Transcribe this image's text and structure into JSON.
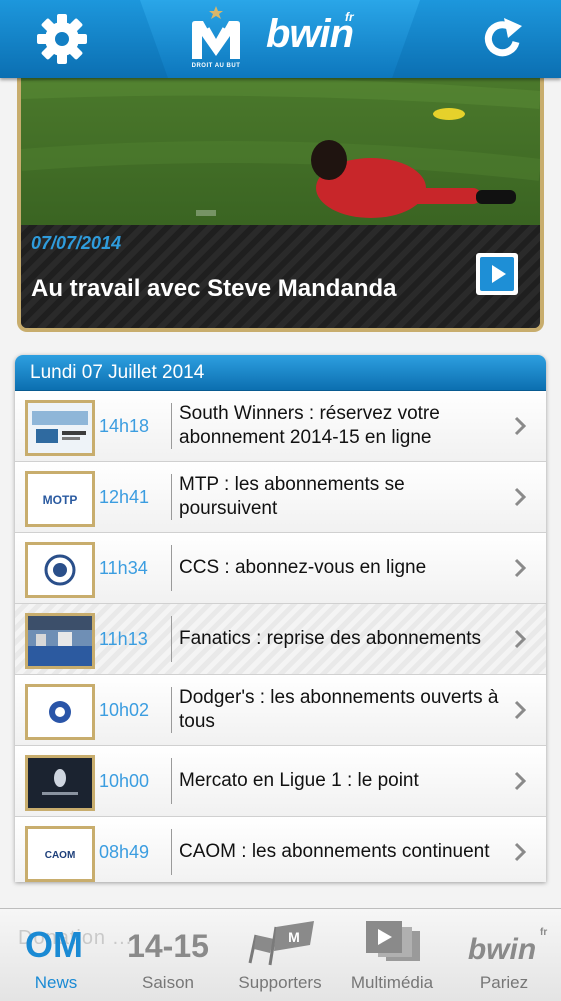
{
  "header": {
    "logo_caption": "DROIT AU BUT",
    "sponsor": "bwin",
    "sponsor_suffix": "fr",
    "settings_icon": "gear-icon",
    "refresh_icon": "refresh-icon"
  },
  "featured": {
    "date": "07/07/2014",
    "title": "Au travail avec Steve Mandanda",
    "play_icon": "play-icon"
  },
  "news": {
    "header": "Lundi 07 Juillet 2014",
    "items": [
      {
        "time": "14h18",
        "title": "South Winners : réservez votre abonnement 2014-15 en ligne"
      },
      {
        "time": "12h41",
        "title": "MTP : les abonnements se poursuivent"
      },
      {
        "time": "11h34",
        "title": "CCS : abonnez-vous en ligne"
      },
      {
        "time": "11h13",
        "title": "Fanatics : reprise des abonnements"
      },
      {
        "time": "10h02",
        "title": "Dodger's : les abonnements ouverts à tous"
      },
      {
        "time": "10h00",
        "title": "Mercato en Ligue 1 : le point"
      },
      {
        "time": "08h49",
        "title": "CAOM : les abonnements continuent"
      }
    ]
  },
  "tabbar": {
    "ghost_text": "Donation ...",
    "tabs": [
      {
        "label": "News",
        "icon_text": "OM"
      },
      {
        "label": "Saison",
        "icon_text": "14-15"
      },
      {
        "label": "Supporters"
      },
      {
        "label": "Multimédia"
      },
      {
        "label": "Pariez",
        "icon_text": "bwin",
        "icon_suffix": "fr"
      }
    ],
    "active": "News",
    "accent": "#1a8ad4"
  }
}
